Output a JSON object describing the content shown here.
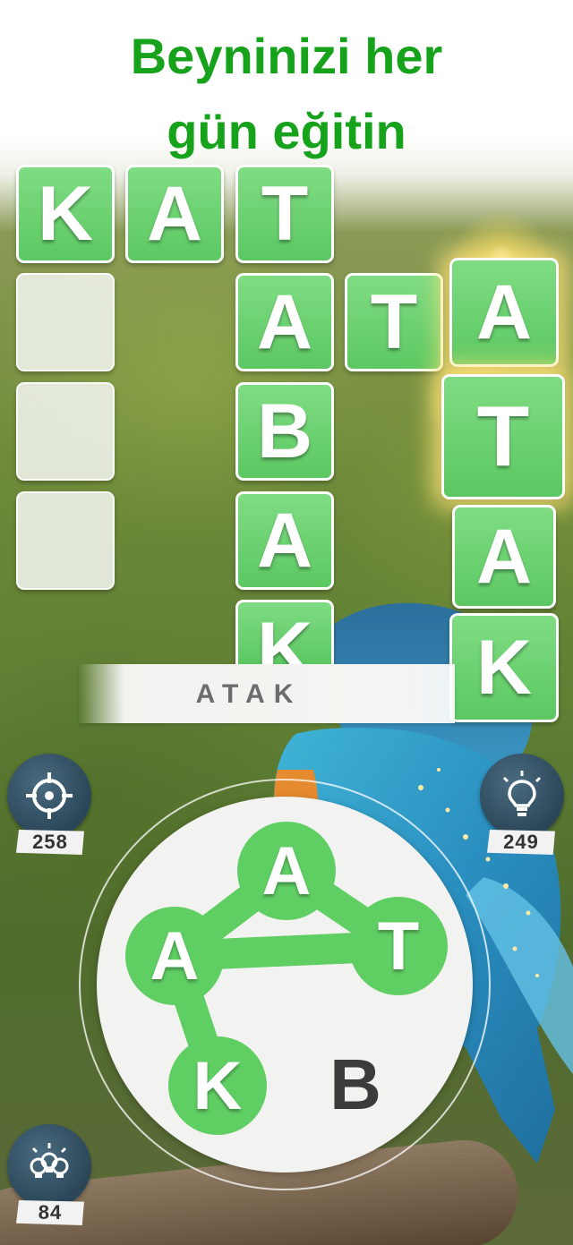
{
  "headline": {
    "line1": "Beyninizi her",
    "line2": "gün eğitin"
  },
  "grid": {
    "row1": [
      "K",
      "A",
      "T"
    ],
    "col_tabak": [
      "A",
      "B",
      "A",
      "K"
    ],
    "row_ata": [
      "T"
    ],
    "col_atak": [
      "A",
      "T",
      "A",
      "K"
    ]
  },
  "current_word": "ATAK",
  "wheel": {
    "letters": [
      "A",
      "T",
      "A",
      "K",
      "B"
    ],
    "selected_path": [
      "A",
      "T",
      "A",
      "K"
    ]
  },
  "counters": {
    "target": "258",
    "hint": "249",
    "multi_hint": "84"
  },
  "icons": {
    "target": "crosshair-icon",
    "hint": "lightbulb-icon",
    "multi_hint": "multi-bulb-icon"
  },
  "colors": {
    "headline": "#17a21c",
    "tile": "#66cc6a",
    "wheel_node": "#5fce63",
    "badge": "#2f4b5f"
  }
}
